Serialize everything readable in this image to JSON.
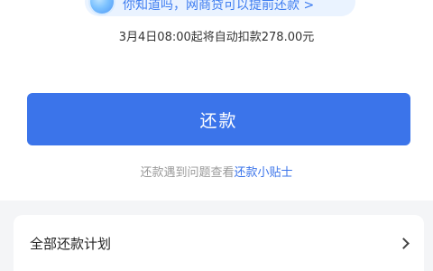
{
  "tip": {
    "text": "你知道吗，网商贷可以提前还款 >",
    "icon": "bubble-icon"
  },
  "deduct_note": "3月4日08:00起将自动扣款278.00元",
  "repay_button_label": "还款",
  "help": {
    "prefix": "还款遇到问题查看",
    "link": "还款小贴士"
  },
  "plan": {
    "label": "全部还款计划",
    "icon": "chevron-right-icon"
  },
  "colors": {
    "accent": "#3b74ea",
    "tip_background": "#eaf3ff",
    "page_background": "#f4f5f7"
  }
}
